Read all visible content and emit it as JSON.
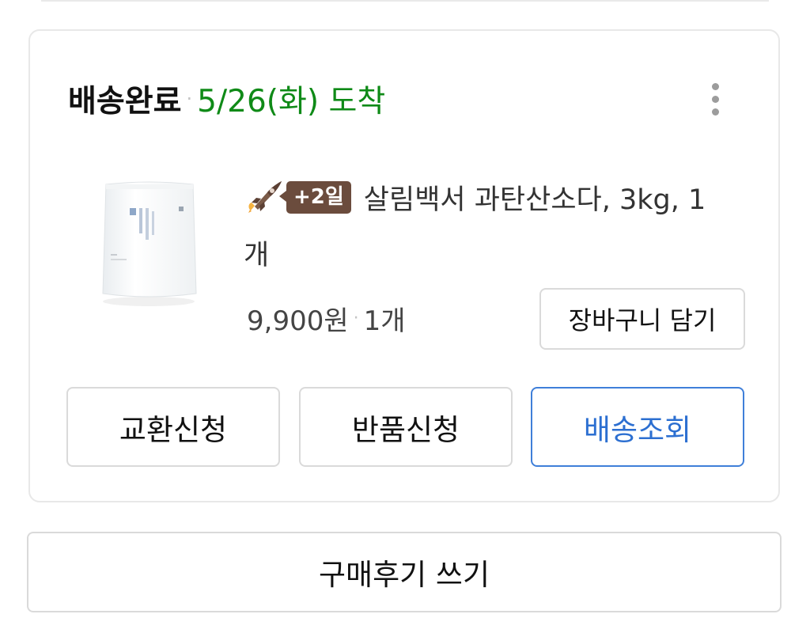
{
  "order": {
    "status": "배송완료",
    "separator": "·",
    "arrival": "5/26(화) 도착",
    "more_icon": "more-vertical-icon",
    "product": {
      "badge": "+2일",
      "title_line1": "살림백서 과탄산소다, 3kg, 1",
      "title_line2": "개",
      "price": "9,900원",
      "quantity": "1개",
      "thumb_label": "과탄산소다"
    },
    "buttons": {
      "cart": "장바구니 담기",
      "exchange": "교환신청",
      "return": "반품신청",
      "tracking": "배송조회"
    }
  },
  "review_button": "구매후기 쓰기",
  "colors": {
    "arrival": "#0f8a17",
    "badge": "#6b4c3d",
    "tracking": "#2c6fd1"
  }
}
